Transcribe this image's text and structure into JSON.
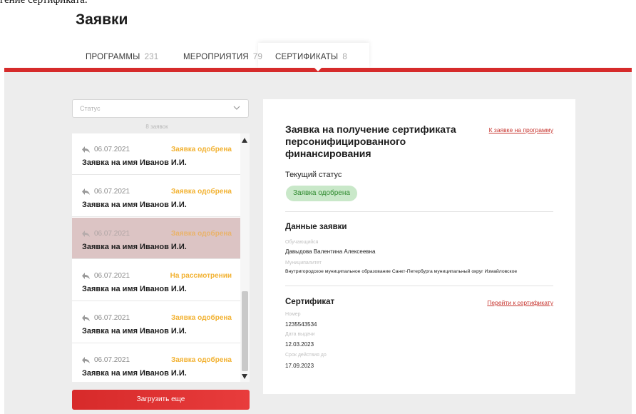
{
  "top_cut_text": "гение сертификата.",
  "page_title": "Заявки",
  "tabs": [
    {
      "label": "ПРОГРАММЫ",
      "count": "231"
    },
    {
      "label": "МЕРОПРИЯТИЯ",
      "count": "79"
    },
    {
      "label": "СЕРТИФИКАТЫ",
      "count": "8",
      "active": true
    }
  ],
  "filter": {
    "placeholder": "Статус"
  },
  "list_count": "8 заявок",
  "items": [
    {
      "date": "06.07.2021",
      "status": "Заявка одобрена",
      "name": "Заявка на имя Иванов И.И."
    },
    {
      "date": "06.07.2021",
      "status": "Заявка одобрена",
      "name": "Заявка на имя Иванов И.И."
    },
    {
      "date": "06.07.2021",
      "status": "Заявка одобрена",
      "name": "Заявка на имя Иванов И.И.",
      "selected": true
    },
    {
      "date": "06.07.2021",
      "status": "На рассмотрении",
      "name": "Заявка на имя Иванов И.И."
    },
    {
      "date": "06.07.2021",
      "status": "Заявка одобрена",
      "name": "Заявка на имя Иванов И.И."
    },
    {
      "date": "06.07.2021",
      "status": "Заявка одобрена",
      "name": "Заявка на имя Иванов И.И."
    }
  ],
  "load_more": "Загрузить еще",
  "detail": {
    "title": "Заявка на получение сертификата персонифицированного финансирования",
    "program_link": "К заявке на программу",
    "status_label": "Текущий статус",
    "status_badge": "Заявка одобрена",
    "data_section": {
      "title": "Данные заявки",
      "student_label": "Обучающийся",
      "student": "Давыдова Валентина Алексеевна",
      "municipality_label": "Муниципалитет",
      "municipality": "Внутригородское муниципальное образование Санкт-Петербурга муниципальный округ Измайловское"
    },
    "certificate_section": {
      "title": "Сертификат",
      "link": "Перейти к сертификату",
      "number_label": "Номер",
      "number": "1235543534",
      "issue_label": "Дата выдачи",
      "issue_date": "12.03.2023",
      "valid_label": "Срок действия до",
      "valid_until": "17.09.2023"
    }
  },
  "colors": {
    "accent": "#d62b2b",
    "pending": "#f2b233",
    "approved_bg": "#c9e8c9",
    "approved_text": "#2f8a2f"
  }
}
